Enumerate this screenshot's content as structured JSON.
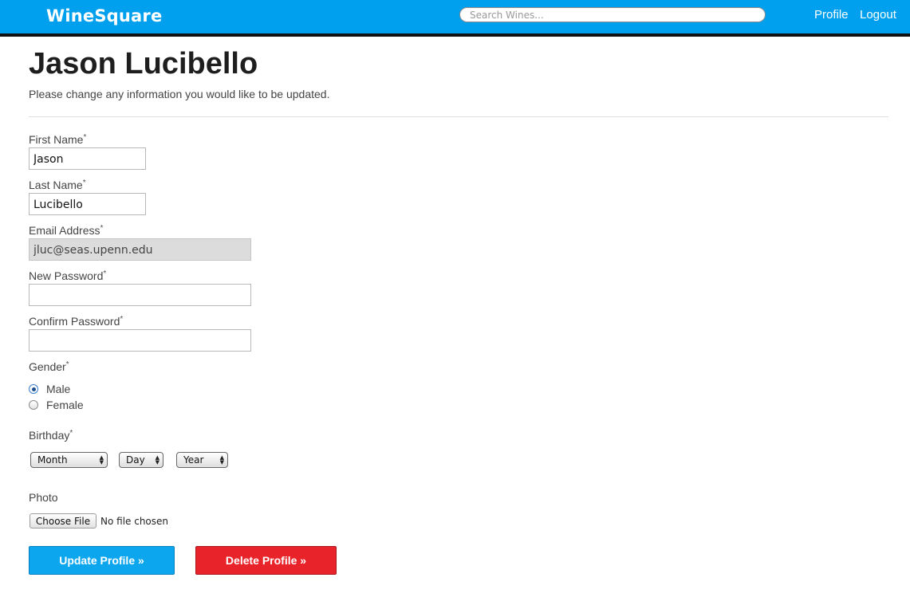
{
  "navbar": {
    "brand": "WineSquare",
    "search_placeholder": "Search Wines...",
    "profile_link": "Profile",
    "logout_link": "Logout",
    "accent_color": "#00a0ee"
  },
  "header": {
    "title": "Jason Lucibello",
    "subtitle": "Please change any information you would like to be updated."
  },
  "form": {
    "required_mark": "*",
    "first_name": {
      "label": "First Name",
      "value": "Jason"
    },
    "last_name": {
      "label": "Last Name",
      "value": "Lucibello"
    },
    "email": {
      "label": "Email Address",
      "value": "jluc@seas.upenn.edu"
    },
    "new_password": {
      "label": "New Password",
      "value": ""
    },
    "confirm_password": {
      "label": "Confirm Password",
      "value": ""
    },
    "gender": {
      "label": "Gender",
      "options": [
        "Male",
        "Female"
      ],
      "selected": "Male"
    },
    "birthday": {
      "label": "Birthday",
      "month": "Month",
      "day": "Day",
      "year": "Year"
    },
    "photo": {
      "label": "Photo",
      "button": "Choose File",
      "status": "No file chosen"
    }
  },
  "actions": {
    "update_label": "Update Profile »",
    "delete_label": "Delete Profile »",
    "update_color": "#0ca6ef",
    "delete_color": "#e8242a"
  }
}
